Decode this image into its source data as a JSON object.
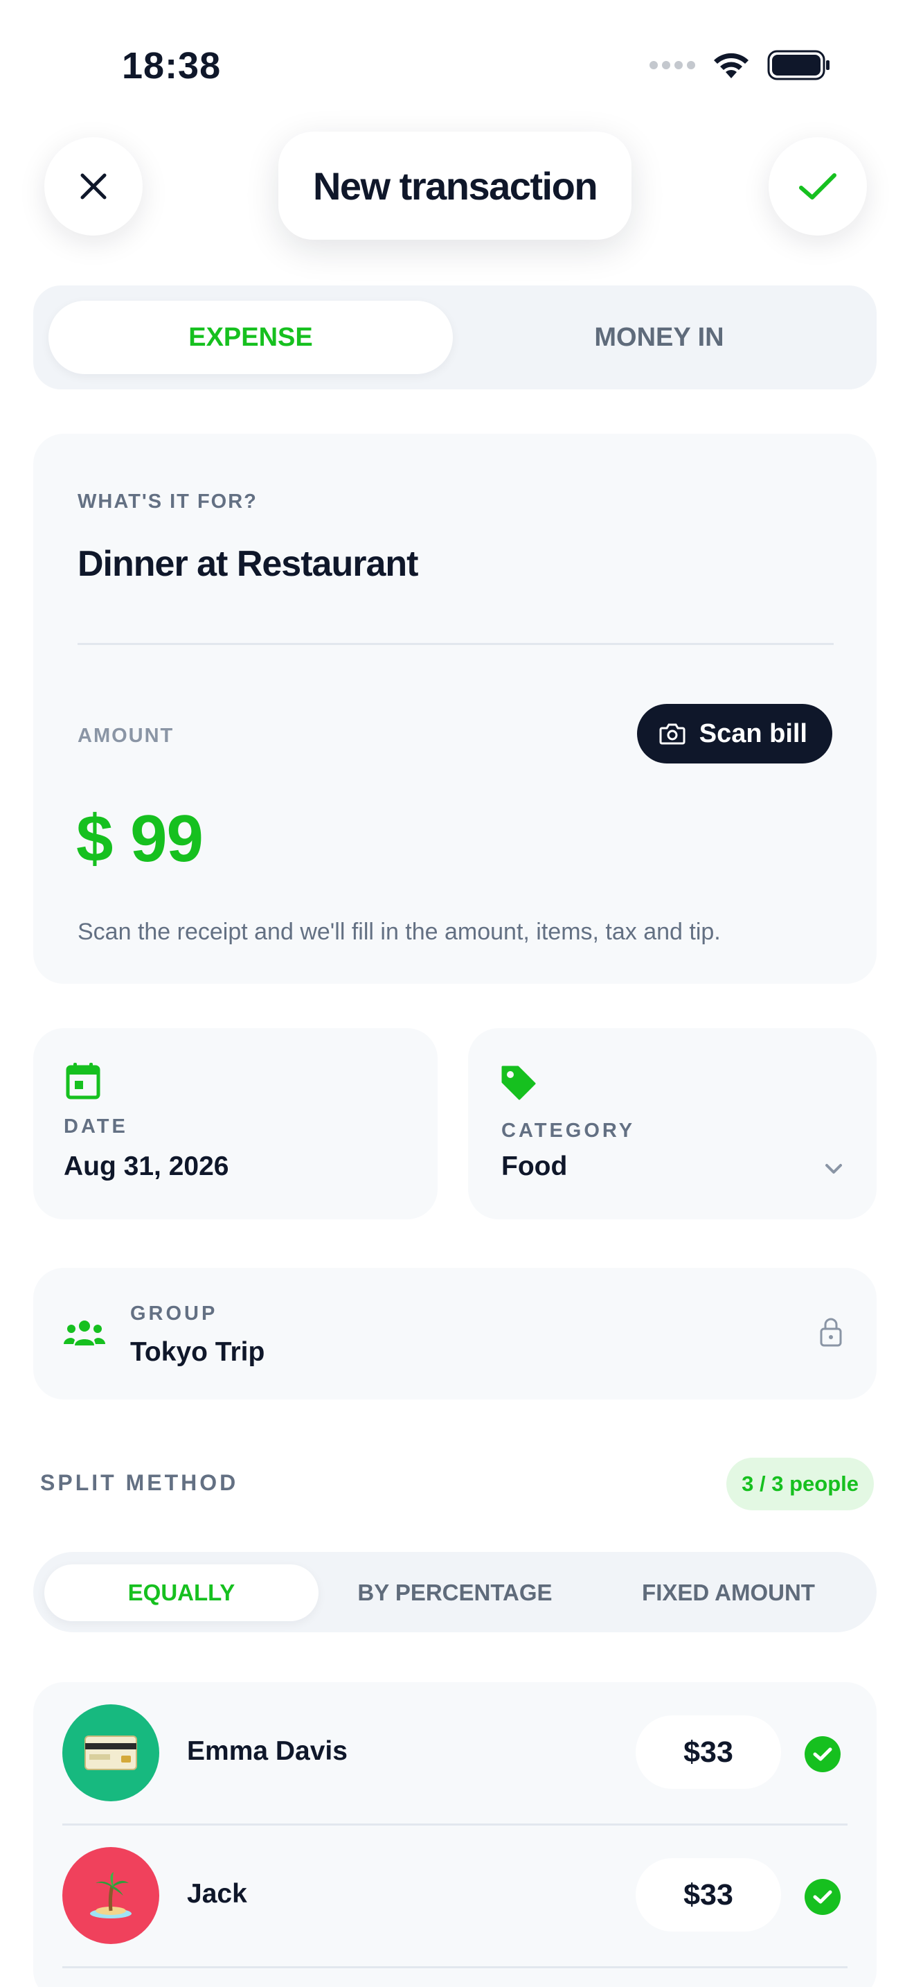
{
  "status_bar": {
    "time": "18:38"
  },
  "header": {
    "title": "New transaction"
  },
  "type_toggle": {
    "active": "EXPENSE",
    "inactive": "MONEY IN"
  },
  "description": {
    "label": "WHAT'S IT FOR?",
    "value": "Dinner at Restaurant"
  },
  "amount": {
    "label": "AMOUNT",
    "currency": "$",
    "value": "99",
    "scan_label": "Scan bill",
    "hint": "Scan the receipt and we'll fill in the amount, items, tax and tip."
  },
  "date": {
    "label": "DATE",
    "value": "Aug 31, 2026"
  },
  "category": {
    "label": "CATEGORY",
    "value": "Food"
  },
  "group": {
    "label": "GROUP",
    "value": "Tokyo Trip"
  },
  "split": {
    "title": "SPLIT METHOD",
    "people_badge": "3 / 3 people",
    "methods": [
      "EQUALLY",
      "BY PERCENTAGE",
      "FIXED AMOUNT"
    ],
    "selected": "EQUALLY"
  },
  "members": [
    {
      "name": "Emma Davis",
      "amount": "$33",
      "avatar_icon": "credit-card-icon",
      "avatar_color": "#17b97f"
    },
    {
      "name": "Jack",
      "amount": "$33",
      "avatar_icon": "island-icon",
      "avatar_color": "#f0415c"
    }
  ],
  "colors": {
    "accent": "#16c01f",
    "dark": "#0f172a",
    "muted": "#637083",
    "card": "#f7f9fb"
  }
}
